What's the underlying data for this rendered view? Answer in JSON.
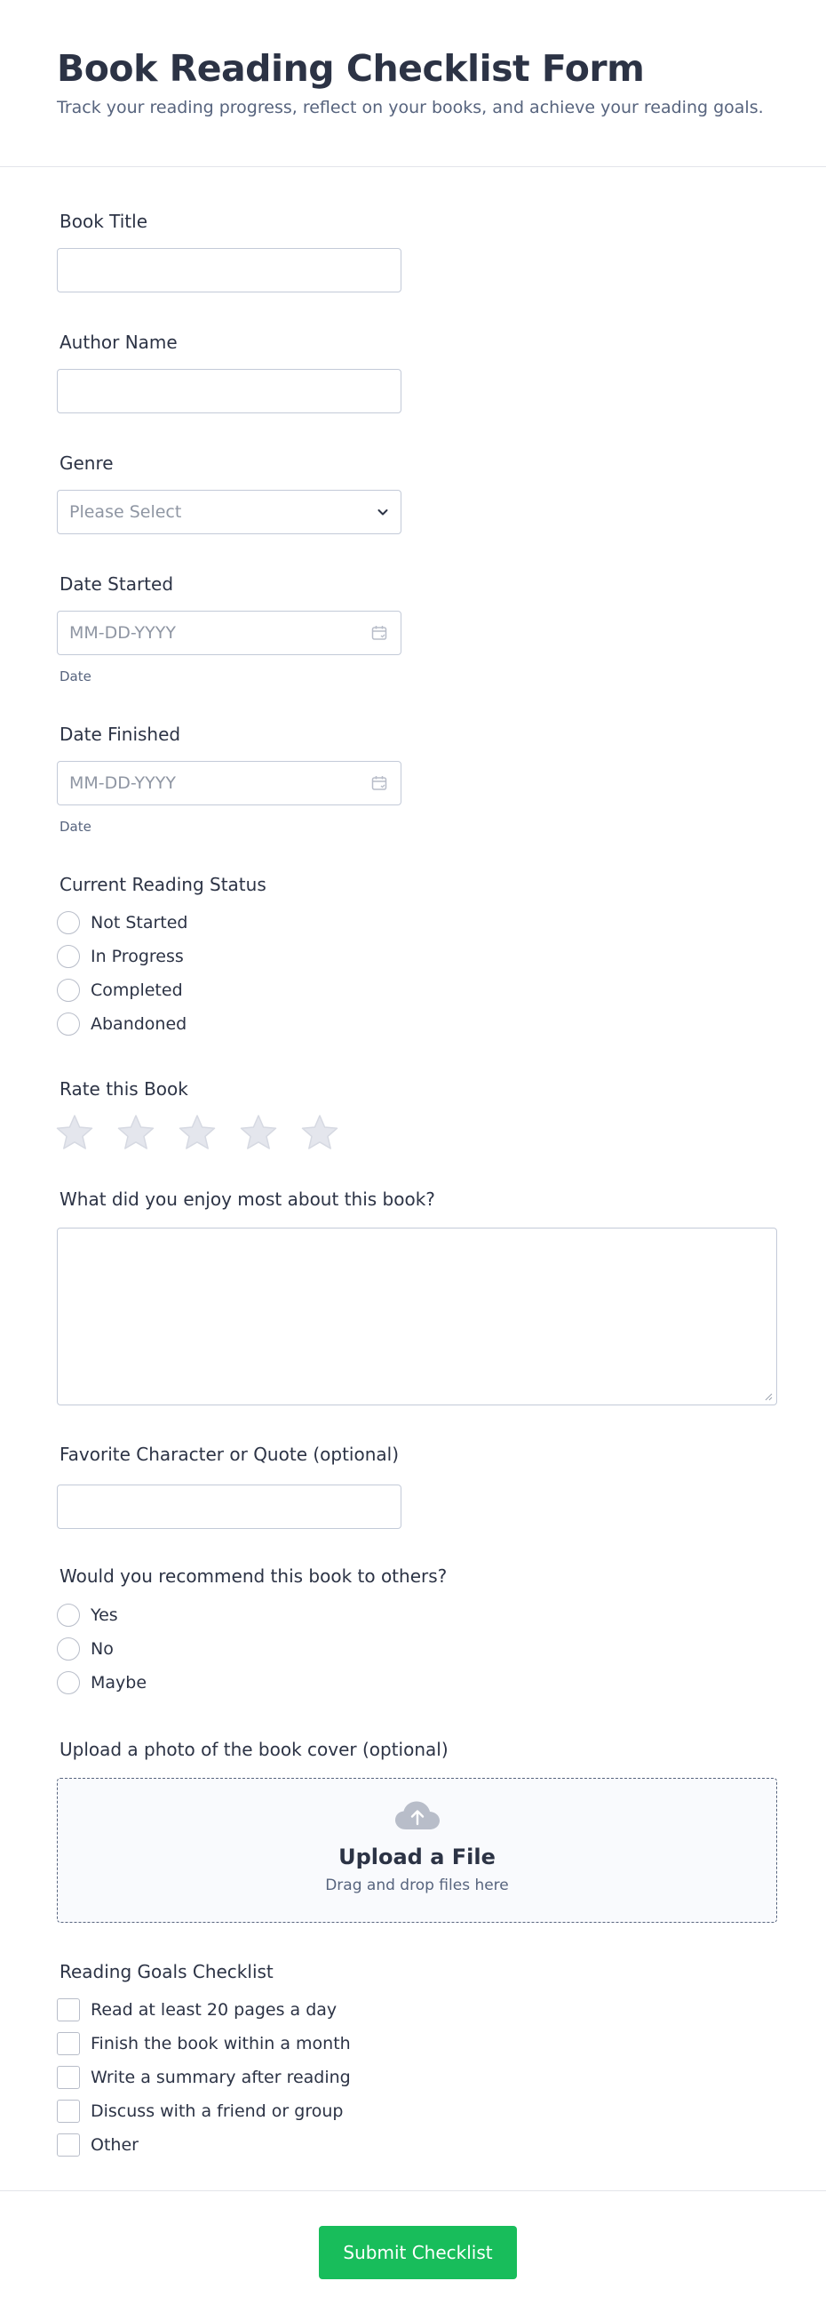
{
  "form": {
    "title": "Book Reading Checklist Form",
    "subtitle": "Track your reading progress, reflect on your books, and achieve your reading goals."
  },
  "fields": {
    "book_title": {
      "label": "Book Title",
      "value": ""
    },
    "author_name": {
      "label": "Author Name",
      "value": ""
    },
    "genre": {
      "label": "Genre",
      "placeholder": "Please Select"
    },
    "date_started": {
      "label": "Date Started",
      "placeholder": "MM-DD-YYYY",
      "sublabel": "Date"
    },
    "date_finished": {
      "label": "Date Finished",
      "placeholder": "MM-DD-YYYY",
      "sublabel": "Date"
    },
    "reading_status": {
      "label": "Current Reading Status",
      "options": [
        "Not Started",
        "In Progress",
        "Completed",
        "Abandoned"
      ]
    },
    "rating": {
      "label": "Rate this Book",
      "max": 5,
      "value": 0
    },
    "enjoyed": {
      "label": "What did you enjoy most about this book?",
      "value": ""
    },
    "favorite": {
      "label": "Favorite Character or Quote (optional)",
      "value": ""
    },
    "recommend": {
      "label": "Would you recommend this book to others?",
      "options": [
        "Yes",
        "No",
        "Maybe"
      ]
    },
    "upload": {
      "label": "Upload a photo of the book cover (optional)",
      "title": "Upload a File",
      "subtitle": "Drag and drop files here"
    },
    "goals": {
      "label": "Reading Goals Checklist",
      "options": [
        "Read at least 20 pages a day",
        "Finish the book within a month",
        "Write a summary after reading",
        "Discuss with a friend or group",
        "Other"
      ]
    }
  },
  "submit": {
    "label": "Submit Checklist"
  },
  "colors": {
    "accent": "#18bd5b",
    "text": "#2c3345",
    "muted": "#57647e",
    "border": "#c3cad8",
    "star": "#e4e6ed"
  },
  "icons": {
    "genre": "chevron-down-icon",
    "date": "calendar-icon",
    "rating": "star-icon",
    "upload": "cloud-upload-icon"
  }
}
